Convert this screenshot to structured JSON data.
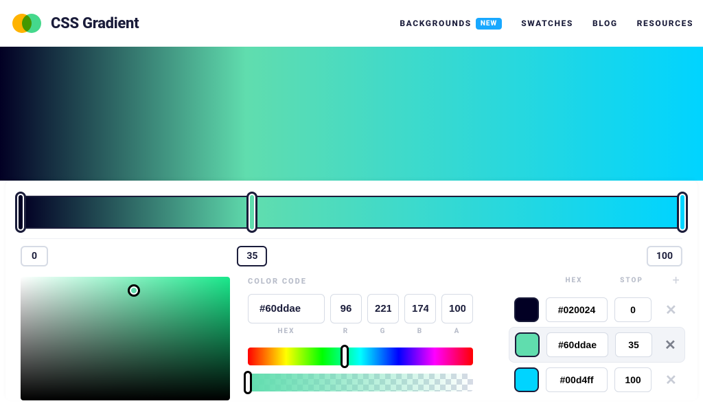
{
  "brand": "CSS Gradient",
  "nav": {
    "backgrounds": "BACKGROUNDS",
    "backgrounds_badge": "NEW",
    "swatches": "SWATCHES",
    "blog": "BLOG",
    "resources": "RESOURCES"
  },
  "gradient": {
    "preview_css": "linear-gradient(90deg, #020024 0%, #60ddae 35%, #00d4ff 100%)",
    "stops": [
      {
        "hex": "#020024",
        "stop": 0,
        "selected": false
      },
      {
        "hex": "#60ddae",
        "stop": 35,
        "selected": true
      },
      {
        "hex": "#00d4ff",
        "stop": 100,
        "selected": false
      }
    ]
  },
  "position_boxes": [
    {
      "value": "0",
      "percent": 0,
      "selected": false
    },
    {
      "value": "35",
      "percent": 35,
      "selected": true
    },
    {
      "value": "100",
      "percent": 100,
      "selected": false
    }
  ],
  "color_code": {
    "section_label": "COLOR CODE",
    "hex": "#60ddae",
    "r": "96",
    "g": "221",
    "b": "174",
    "a": "100",
    "labels": {
      "hex": "HEX",
      "r": "R",
      "g": "G",
      "b": "B",
      "a": "A"
    },
    "hue_percent": 43,
    "alpha_percent": 0
  },
  "stops_list": {
    "head_hex": "HEX",
    "head_stop": "STOP",
    "add_icon": "+",
    "remove_icon": "✕"
  }
}
